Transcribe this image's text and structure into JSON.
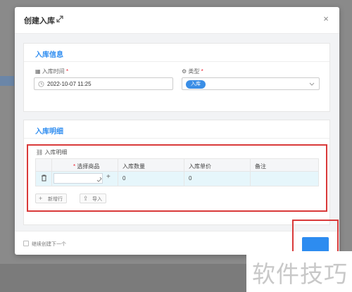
{
  "dialog": {
    "title": "创建入库",
    "icons": {
      "expand": "expand-icon",
      "close": "close-icon"
    }
  },
  "info_section": {
    "title": "入库信息",
    "time_label": "入库时间",
    "time_value": "2022-10-07 11:25",
    "type_label": "类型",
    "type_value": "入库",
    "required_mark": "*"
  },
  "detail_section": {
    "title": "入库明细",
    "table_caption": "入库明细",
    "columns": [
      "选择商品",
      "入库数量",
      "入库单价",
      "备注"
    ],
    "rows": [
      {
        "product": "",
        "quantity": "0",
        "unit_price": "0",
        "remark": ""
      }
    ],
    "add_row_label": "新增行",
    "import_label": "导入"
  },
  "footer": {
    "continue_label": "继续创建下一个",
    "continue_checked": false
  },
  "watermark": "软件技巧",
  "colors": {
    "accent": "#2d8cf0",
    "highlight": "#d93a3a",
    "row_selected": "#e6f6fb"
  }
}
